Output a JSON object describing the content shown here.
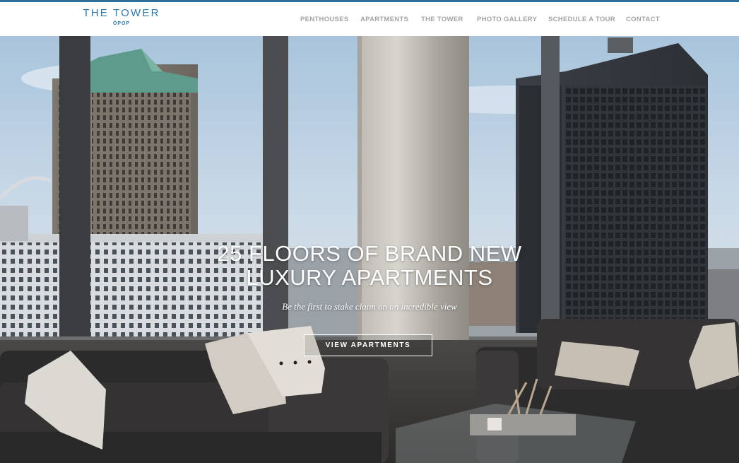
{
  "header": {
    "logo_title": "THE TOWER",
    "logo_subtitle": "ÖPOP",
    "nav": {
      "penthouses": "PENTHOUSES",
      "apartments": "APARTMENTS",
      "the_tower": "THE TOWER",
      "photo_gallery": "PHOTO GALLERY",
      "schedule_tour": "SCHEDULE A TOUR",
      "contact": "CONTACT"
    }
  },
  "hero": {
    "headline_line1": "25 FLOORS OF BRAND NEW",
    "headline_line2": "LUXURY APARTMENTS",
    "subheadline": "Be the first to stake claim on an incredible view",
    "cta_label": "VIEW APARTMENTS"
  },
  "colors": {
    "brand_blue": "#2a7ab0",
    "nav_gray": "#a3a3a3",
    "hero_text": "#ffffff"
  }
}
